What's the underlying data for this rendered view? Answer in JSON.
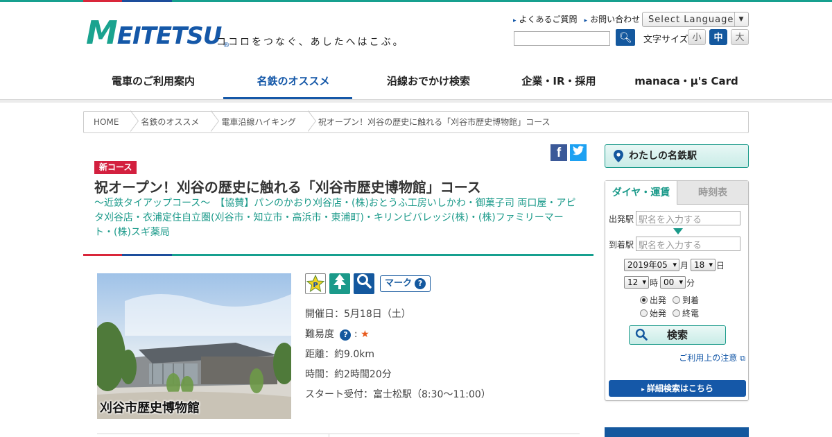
{
  "header": {
    "logo_text": "MEITETSU",
    "logo_reg": "®",
    "tagline": "ココロをつなぐ、あしたへはこぶ。",
    "util_links": [
      "よくあるご質問",
      "お問い合わせ"
    ],
    "language_select": "Select Language",
    "font_size_label": "文字サイズ",
    "font_sizes": [
      "小",
      "中",
      "大"
    ]
  },
  "nav": {
    "items": [
      "電車のご利用案内",
      "名鉄のオススメ",
      "沿線おでかけ検索",
      "企業・IR・採用",
      "manaca・μ's Card"
    ],
    "active_index": 1
  },
  "breadcrumb": [
    "HOME",
    "名鉄のオススメ",
    "電車沿線ハイキング",
    "祝オープン！刈谷の歴史に触れる「刈谷市歴史博物館」コース"
  ],
  "course": {
    "badge": "新コース",
    "title": "祝オープン！刈谷の歴史に触れる「刈谷市歴史博物館」コース",
    "subtitle": "～近鉄タイアップコース～　【協賛】パンのかおり刈谷店・(株)おとうふ工房いしかわ・御菓子司 両口屋・アピタ刈谷店・衣浦定住自立圏(刈谷市・知立市・高浜市・東浦町)・キリンビバレッジ(株)・(株)ファミリーマート・(株)スギ薬局",
    "photo_caption": "刈谷市歴史博物館",
    "mark_button": "マーク",
    "date": "開催日：5月18日（土）",
    "difficulty_label": "難易度",
    "difficulty_stars": "★",
    "distance": "距離：約9.0km",
    "time": "時間：約2時間20分",
    "start": "スタート受付：富士松駅（8:30～11:00）"
  },
  "sidebar": {
    "my_station": "わたしの名鉄駅",
    "tabs": [
      "ダイヤ・運賃",
      "時刻表"
    ],
    "from_label": "出発駅",
    "to_label": "到着駅",
    "station_placeholder": "駅名を入力する",
    "year_month": "2019年05",
    "month_unit": "月",
    "day": "18",
    "day_unit": "日",
    "hour": "12",
    "hour_unit": "時",
    "minute": "00",
    "minute_unit": "分",
    "radios": [
      "出発",
      "到着",
      "始発",
      "終電"
    ],
    "search_button": "検索",
    "notice": "ご利用上の注意",
    "detail_button": "詳細検索はこちら"
  },
  "colors": {
    "brand_blue": "#1558a8",
    "brand_green": "#1b9a8a",
    "brand_red": "#d3203f"
  }
}
